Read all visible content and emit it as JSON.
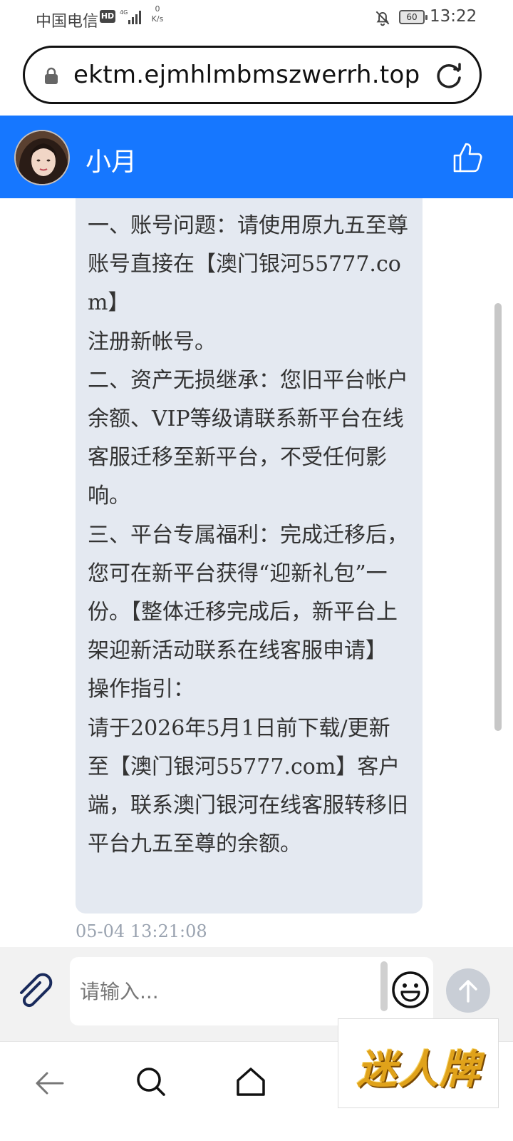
{
  "status_bar": {
    "carrier": "中国电信",
    "hd_badge": "HD",
    "network": "4G",
    "speed_value": "0",
    "speed_unit": "K/s",
    "battery": "60",
    "time": "13:22"
  },
  "browser": {
    "url": "ektm.ejmhlmbmszwerrh.top"
  },
  "chat": {
    "contact_name": "小月",
    "message": {
      "text": "一、账号问题：请使用原九五至尊账号直接在【澳门银河55777.com】\n注册新帐号。\n二、资产无损继承：您旧平台帐户余额、VIP等级请联系新平台在线客服迁移至新平台，不受任何影响。\n三、平台专属福利：完成迁移后，您可在新平台获得“迎新礼包”一份。【整体迁移完成后，新平台上架迎新活动联系在线客服申请】\n操作指引：\n请于2026年5月1日前下载/更新至【澳门银河55777.com】客户端，联系澳门银河在线客服转移旧平台九五至尊的余额。",
      "timestamp": "05-04 13:21:08"
    }
  },
  "input": {
    "placeholder": "请输入..."
  },
  "watermark": {
    "text": "迷人牌"
  },
  "colors": {
    "header_bg": "#1677ff",
    "bubble_bg": "#e4e9f1",
    "input_bar_bg": "#f2f2f2",
    "send_button": "#c9ced6"
  }
}
